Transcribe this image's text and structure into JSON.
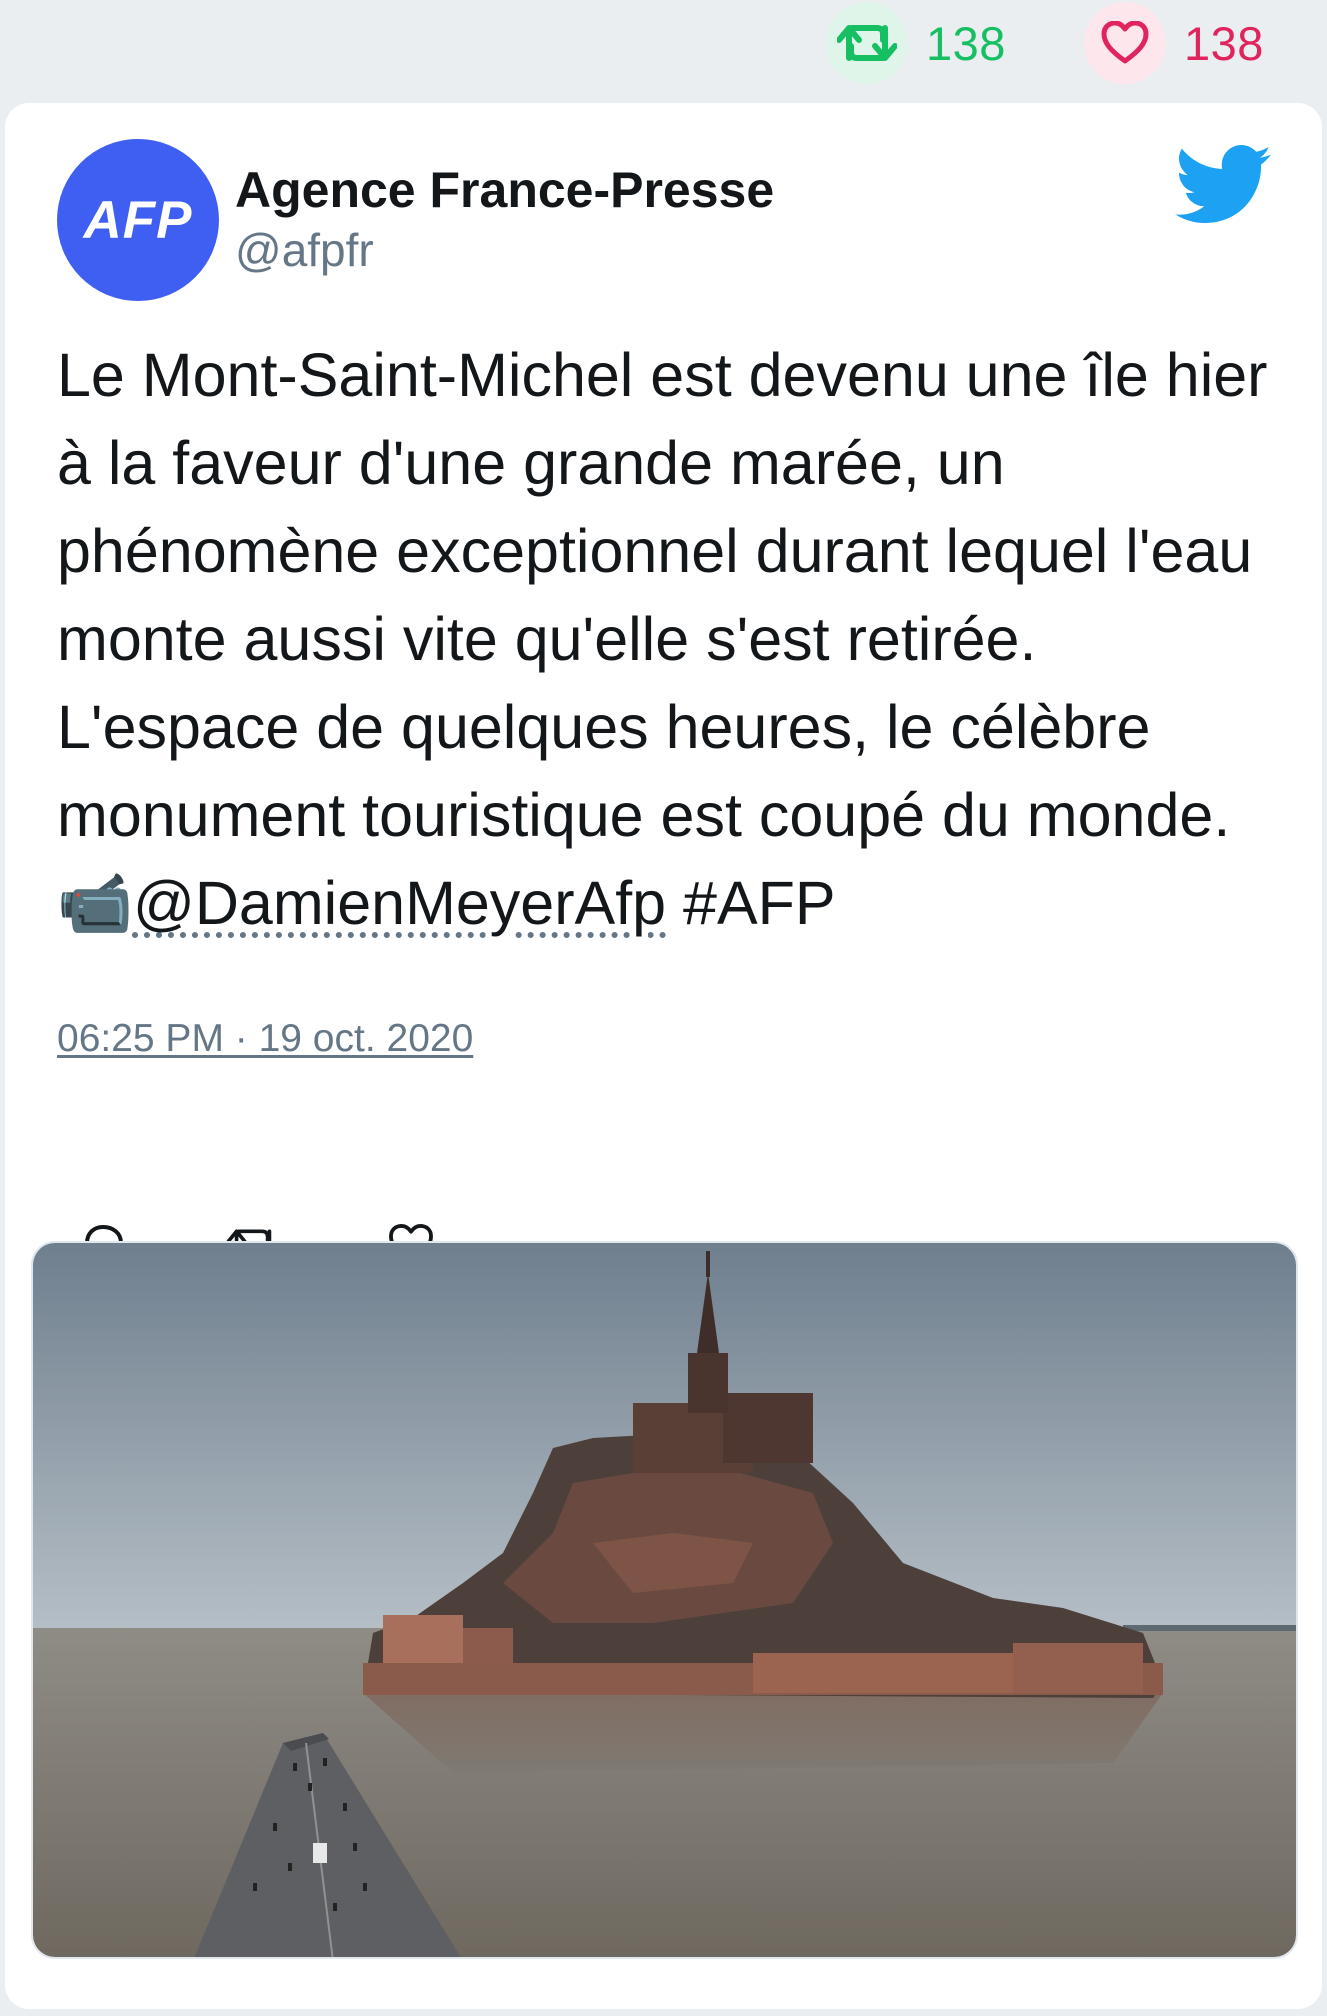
{
  "stats": {
    "retweets": "138",
    "likes": "138"
  },
  "author": {
    "avatar_text": "AFP",
    "name": "Agence France-Presse",
    "handle": "@afpfr"
  },
  "tweet": {
    "text_before": "Le Mont-Saint-Michel est devenu une île hier à la faveur d'une grande marée, un phénomène exceptionnel durant lequel l'eau monte aussi vite qu'elle s'est retirée. L'espace de quelques heures, le célèbre monument touristique est coupé du monde. ",
    "camera_emoji": "📹",
    "mention": "@DamienMeyerAfp",
    "hashtag": " #AFP",
    "timestamp": "06:25 PM · 19 oct. 2020"
  },
  "colors": {
    "retweet_green": "#17bf63",
    "like_red": "#e0245e",
    "twitter_blue": "#1da1f2",
    "avatar_blue": "#3f5ff2",
    "muted_gray": "#657786"
  },
  "icons": {
    "retweet": "retweet-icon",
    "like": "heart-icon",
    "brand": "twitter-bird-icon",
    "reply": "reply-icon"
  }
}
